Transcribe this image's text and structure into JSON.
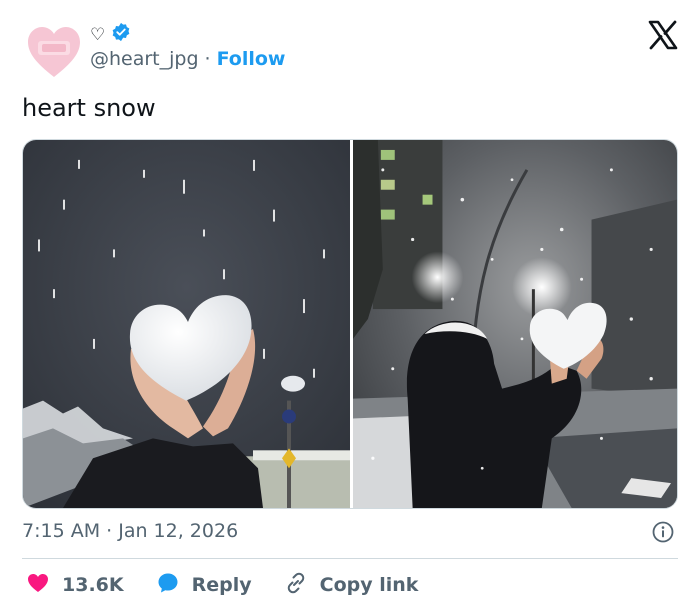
{
  "author": {
    "name_glyph": "♡",
    "handle": "@heart_jpg",
    "separator": "·",
    "follow_label": "Follow"
  },
  "tweet": {
    "text": "heart snow"
  },
  "meta": {
    "timestamp": "7:15 AM · Jan 12, 2026"
  },
  "actions": {
    "likes": "13.6K",
    "reply_label": "Reply",
    "copy_link_label": "Copy link"
  },
  "colors": {
    "accent": "#1d9bf0",
    "like": "#f91880",
    "muted": "#536471"
  },
  "icons": [
    "avatar-heart",
    "verified-badge",
    "x-logo",
    "info-icon",
    "heart-icon",
    "reply-bubble-icon",
    "link-icon"
  ]
}
